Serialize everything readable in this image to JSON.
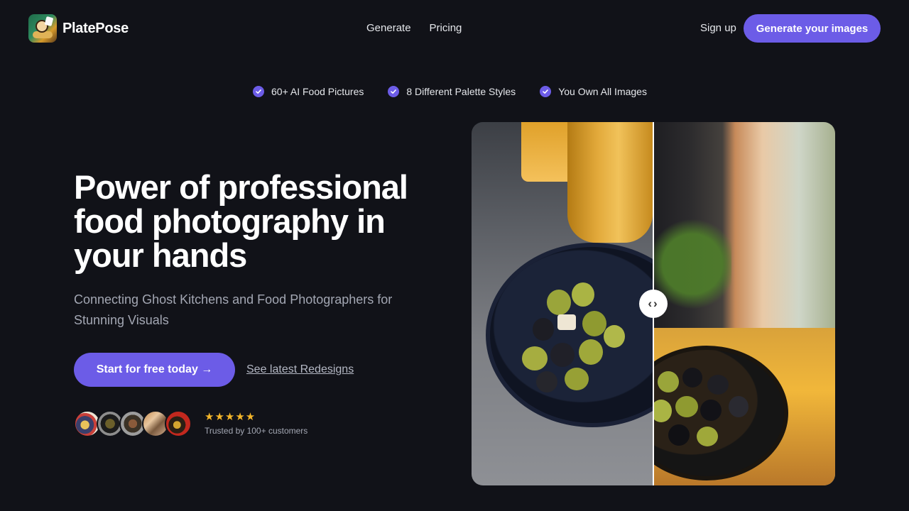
{
  "brand": {
    "name": "PlatePose"
  },
  "nav": {
    "links": [
      "Generate",
      "Pricing"
    ],
    "signup": "Sign up",
    "cta": "Generate your images"
  },
  "features": [
    "60+ AI Food Pictures",
    "8 Different Palette Styles",
    "You Own All Images"
  ],
  "hero": {
    "headline": "Power of professional food photography in your hands",
    "subtitle": "Connecting Ghost Kitchens and Food Photographers for Stunning Visuals",
    "primary_cta": "Start for free today →",
    "secondary_link": "See latest Redesigns",
    "rating_stars": "★★★★★",
    "trusted_text": "Trusted by 100+ customers"
  },
  "compare": {
    "handle_icon": "‹›"
  },
  "colors": {
    "background": "#111218",
    "accent": "#6c5ce7",
    "star": "#f5b62a"
  }
}
